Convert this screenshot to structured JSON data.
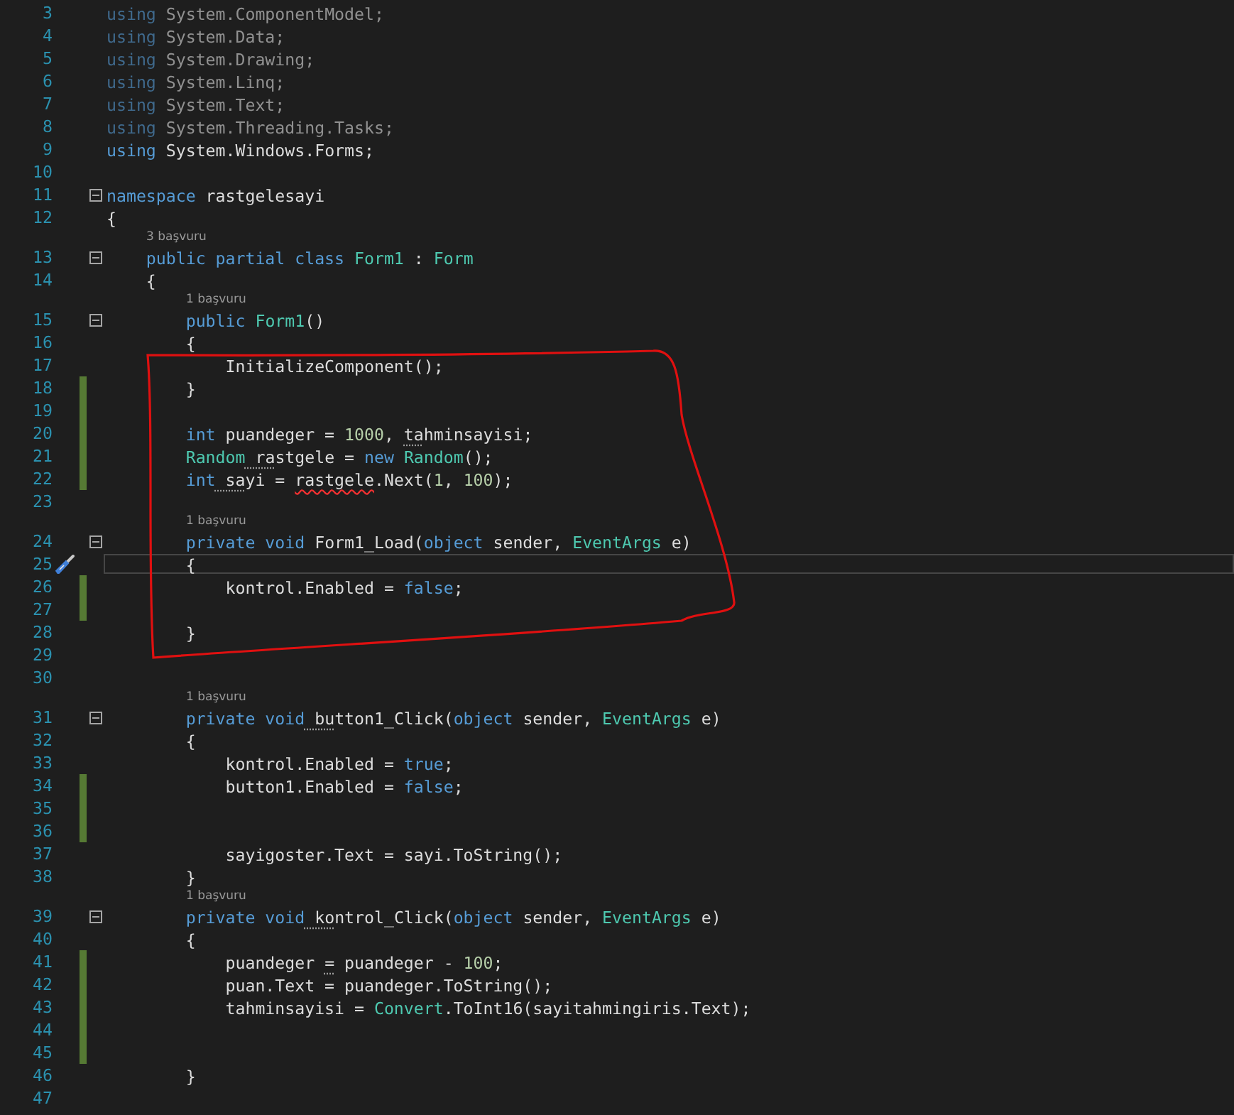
{
  "editor": {
    "lines": [
      {
        "number": "3",
        "changed": false,
        "current": false,
        "foldable": false,
        "quick_action": false,
        "tokens": [
          {
            "kind": "dim-keyword",
            "text": "using"
          },
          {
            "kind": "dim-plain",
            "text": " System.ComponentModel;"
          }
        ]
      },
      {
        "number": "4",
        "changed": false,
        "current": false,
        "foldable": false,
        "quick_action": false,
        "tokens": [
          {
            "kind": "dim-keyword",
            "text": "using"
          },
          {
            "kind": "dim-plain",
            "text": " System.Data;"
          }
        ]
      },
      {
        "number": "5",
        "changed": false,
        "current": false,
        "foldable": false,
        "quick_action": false,
        "tokens": [
          {
            "kind": "dim-keyword",
            "text": "using"
          },
          {
            "kind": "dim-plain",
            "text": " System.Drawing;"
          }
        ]
      },
      {
        "number": "6",
        "changed": false,
        "current": false,
        "foldable": false,
        "quick_action": false,
        "tokens": [
          {
            "kind": "dim-keyword",
            "text": "using"
          },
          {
            "kind": "dim-plain",
            "text": " System.Linq;"
          }
        ]
      },
      {
        "number": "7",
        "changed": false,
        "current": false,
        "foldable": false,
        "quick_action": false,
        "tokens": [
          {
            "kind": "dim-keyword",
            "text": "using"
          },
          {
            "kind": "dim-plain",
            "text": " System.Text;"
          }
        ]
      },
      {
        "number": "8",
        "changed": false,
        "current": false,
        "foldable": false,
        "quick_action": false,
        "tokens": [
          {
            "kind": "dim-keyword",
            "text": "using"
          },
          {
            "kind": "dim-plain",
            "text": " System.Threading.Tasks;"
          }
        ]
      },
      {
        "number": "9",
        "changed": false,
        "current": false,
        "foldable": false,
        "quick_action": false,
        "tokens": [
          {
            "kind": "keyword",
            "text": "using"
          },
          {
            "kind": "plain",
            "text": " System.Windows.Forms;"
          }
        ]
      },
      {
        "number": "10",
        "changed": false,
        "current": false,
        "foldable": false,
        "quick_action": false
      },
      {
        "number": "11",
        "changed": false,
        "current": false,
        "foldable": true,
        "quick_action": false,
        "tokens": [
          {
            "kind": "keyword",
            "text": "namespace"
          },
          {
            "kind": "plain",
            "text": " rastgelesayi"
          }
        ]
      },
      {
        "number": "12",
        "changed": false,
        "current": false,
        "foldable": false,
        "quick_action": false,
        "tokens": [
          {
            "kind": "plain",
            "text": "{"
          }
        ]
      },
      {
        "number": "13",
        "codelens": "3 başvuru",
        "changed": false,
        "current": false,
        "foldable": true,
        "quick_action": false,
        "tokens": [
          {
            "kind": "keyword",
            "text": "    public partial class"
          },
          {
            "kind": "type",
            "text": " Form1"
          },
          {
            "kind": "plain",
            "text": " : "
          },
          {
            "kind": "type",
            "text": "Form"
          }
        ]
      },
      {
        "number": "14",
        "changed": false,
        "current": false,
        "foldable": false,
        "quick_action": false,
        "tokens": [
          {
            "kind": "plain",
            "text": "    {"
          }
        ]
      },
      {
        "number": "15",
        "codelens": "1 başvuru",
        "changed": false,
        "current": false,
        "foldable": true,
        "quick_action": false,
        "tokens": [
          {
            "kind": "keyword",
            "text": "        public"
          },
          {
            "kind": "type",
            "text": " Form1"
          },
          {
            "kind": "plain",
            "text": "()"
          }
        ]
      },
      {
        "number": "16",
        "changed": false,
        "current": false,
        "foldable": false,
        "quick_action": false,
        "tokens": [
          {
            "kind": "plain",
            "text": "        {"
          }
        ]
      },
      {
        "number": "17",
        "changed": false,
        "current": false,
        "foldable": false,
        "quick_action": false,
        "tokens": [
          {
            "kind": "plain",
            "text": "            InitializeComponent();"
          }
        ]
      },
      {
        "number": "18",
        "changed": true,
        "current": false,
        "foldable": false,
        "quick_action": false,
        "tokens": [
          {
            "kind": "plain",
            "text": "        }"
          }
        ]
      },
      {
        "number": "19",
        "changed": true,
        "current": false,
        "foldable": false,
        "quick_action": false
      },
      {
        "number": "20",
        "changed": true,
        "current": false,
        "foldable": false,
        "quick_action": false,
        "tokens": [
          {
            "kind": "keyword",
            "text": "        int"
          },
          {
            "kind": "plain",
            "text": " puandeger = "
          },
          {
            "kind": "number",
            "text": "1000"
          },
          {
            "kind": "plain",
            "text": ", "
          },
          {
            "kind": "hint",
            "text": "ta"
          },
          {
            "kind": "plain",
            "text": "hminsayisi;"
          }
        ]
      },
      {
        "number": "21",
        "changed": true,
        "current": false,
        "foldable": false,
        "quick_action": false,
        "tokens": [
          {
            "kind": "type",
            "text": "        Random"
          },
          {
            "kind": "hint",
            "text": " ra"
          },
          {
            "kind": "plain",
            "text": "stgele = "
          },
          {
            "kind": "keyword",
            "text": "new"
          },
          {
            "kind": "type",
            "text": " Random"
          },
          {
            "kind": "plain",
            "text": "();"
          }
        ]
      },
      {
        "number": "22",
        "changed": true,
        "current": false,
        "foldable": false,
        "quick_action": false,
        "tokens": [
          {
            "kind": "keyword",
            "text": "        int"
          },
          {
            "kind": "hint",
            "text": " sa"
          },
          {
            "kind": "plain",
            "text": "yi = "
          },
          {
            "kind": "error",
            "text": "rastgele"
          },
          {
            "kind": "plain",
            "text": ".Next("
          },
          {
            "kind": "number",
            "text": "1"
          },
          {
            "kind": "plain",
            "text": ", "
          },
          {
            "kind": "number",
            "text": "100"
          },
          {
            "kind": "plain",
            "text": ");"
          }
        ]
      },
      {
        "number": "23",
        "changed": false,
        "current": false,
        "foldable": false,
        "quick_action": false
      },
      {
        "number": "24",
        "codelens": "1 başvuru",
        "changed": false,
        "current": false,
        "foldable": true,
        "quick_action": false,
        "tokens": [
          {
            "kind": "keyword",
            "text": "        private void"
          },
          {
            "kind": "plain",
            "text": " Form1_Load("
          },
          {
            "kind": "keyword",
            "text": "object"
          },
          {
            "kind": "plain",
            "text": " sender, "
          },
          {
            "kind": "type",
            "text": "EventArgs"
          },
          {
            "kind": "plain",
            "text": " e)"
          }
        ]
      },
      {
        "number": "25",
        "changed": false,
        "current": true,
        "foldable": false,
        "quick_action": true,
        "tokens": [
          {
            "kind": "plain",
            "text": "        {"
          }
        ]
      },
      {
        "number": "26",
        "changed": true,
        "current": false,
        "foldable": false,
        "quick_action": false,
        "tokens": [
          {
            "kind": "plain",
            "text": "            kontrol.Enabled = "
          },
          {
            "kind": "keyword",
            "text": "false"
          },
          {
            "kind": "plain",
            "text": ";"
          }
        ]
      },
      {
        "number": "27",
        "changed": true,
        "current": false,
        "foldable": false,
        "quick_action": false
      },
      {
        "number": "28",
        "changed": false,
        "current": false,
        "foldable": false,
        "quick_action": false,
        "tokens": [
          {
            "kind": "plain",
            "text": "        }"
          }
        ]
      },
      {
        "number": "29",
        "changed": false,
        "current": false,
        "foldable": false,
        "quick_action": false
      },
      {
        "number": "30",
        "changed": false,
        "current": false,
        "foldable": false,
        "quick_action": false
      },
      {
        "number": "31",
        "codelens": "1 başvuru",
        "changed": false,
        "current": false,
        "foldable": true,
        "quick_action": false,
        "tokens": [
          {
            "kind": "keyword",
            "text": "        private void"
          },
          {
            "kind": "hint",
            "text": " bu"
          },
          {
            "kind": "plain",
            "text": "tton1_Click("
          },
          {
            "kind": "keyword",
            "text": "object"
          },
          {
            "kind": "plain",
            "text": " sender, "
          },
          {
            "kind": "type",
            "text": "EventArgs"
          },
          {
            "kind": "plain",
            "text": " e)"
          }
        ]
      },
      {
        "number": "32",
        "changed": false,
        "current": false,
        "foldable": false,
        "quick_action": false,
        "tokens": [
          {
            "kind": "plain",
            "text": "        {"
          }
        ]
      },
      {
        "number": "33",
        "changed": false,
        "current": false,
        "foldable": false,
        "quick_action": false,
        "tokens": [
          {
            "kind": "plain",
            "text": "            kontrol.Enabled = "
          },
          {
            "kind": "keyword",
            "text": "true"
          },
          {
            "kind": "plain",
            "text": ";"
          }
        ]
      },
      {
        "number": "34",
        "changed": true,
        "current": false,
        "foldable": false,
        "quick_action": false,
        "tokens": [
          {
            "kind": "plain",
            "text": "            button1.Enabled = "
          },
          {
            "kind": "keyword",
            "text": "false"
          },
          {
            "kind": "plain",
            "text": ";"
          }
        ]
      },
      {
        "number": "35",
        "changed": true,
        "current": false,
        "foldable": false,
        "quick_action": false
      },
      {
        "number": "36",
        "changed": true,
        "current": false,
        "foldable": false,
        "quick_action": false
      },
      {
        "number": "37",
        "changed": false,
        "current": false,
        "foldable": false,
        "quick_action": false,
        "tokens": [
          {
            "kind": "plain",
            "text": "            sayigoster.Text = sayi.ToString();"
          }
        ]
      },
      {
        "number": "38",
        "changed": false,
        "current": false,
        "foldable": false,
        "quick_action": false,
        "tokens": [
          {
            "kind": "plain",
            "text": "        }"
          }
        ]
      },
      {
        "number": "39",
        "codelens": "1 başvuru",
        "changed": false,
        "current": false,
        "foldable": true,
        "quick_action": false,
        "tokens": [
          {
            "kind": "keyword",
            "text": "        private void"
          },
          {
            "kind": "hint",
            "text": " ko"
          },
          {
            "kind": "plain",
            "text": "ntrol_Click("
          },
          {
            "kind": "keyword",
            "text": "object"
          },
          {
            "kind": "plain",
            "text": " sender, "
          },
          {
            "kind": "type",
            "text": "EventArgs"
          },
          {
            "kind": "plain",
            "text": " e)"
          }
        ]
      },
      {
        "number": "40",
        "changed": false,
        "current": false,
        "foldable": false,
        "quick_action": false,
        "tokens": [
          {
            "kind": "plain",
            "text": "        {"
          }
        ]
      },
      {
        "number": "41",
        "changed": true,
        "current": false,
        "foldable": false,
        "quick_action": false,
        "tokens": [
          {
            "kind": "plain",
            "text": "            puandeger "
          },
          {
            "kind": "hint",
            "text": "="
          },
          {
            "kind": "plain",
            "text": " puandeger - "
          },
          {
            "kind": "number",
            "text": "100"
          },
          {
            "kind": "plain",
            "text": ";"
          }
        ]
      },
      {
        "number": "42",
        "changed": true,
        "current": false,
        "foldable": false,
        "quick_action": false,
        "tokens": [
          {
            "kind": "plain",
            "text": "            puan.Text = puandeger.ToString();"
          }
        ]
      },
      {
        "number": "43",
        "changed": true,
        "current": false,
        "foldable": false,
        "quick_action": false,
        "tokens": [
          {
            "kind": "plain",
            "text": "            tahminsayisi = "
          },
          {
            "kind": "type",
            "text": "Convert"
          },
          {
            "kind": "plain",
            "text": ".ToInt16(sayitahmingiris.Text);"
          }
        ]
      },
      {
        "number": "44",
        "changed": true,
        "current": false,
        "foldable": false,
        "quick_action": false
      },
      {
        "number": "45",
        "changed": true,
        "current": false,
        "foldable": false,
        "quick_action": false
      },
      {
        "number": "46",
        "changed": false,
        "current": false,
        "foldable": false,
        "quick_action": false,
        "tokens": [
          {
            "kind": "plain",
            "text": "        }"
          }
        ]
      },
      {
        "number": "47",
        "changed": false,
        "current": false,
        "foldable": false,
        "quick_action": false
      }
    ]
  }
}
